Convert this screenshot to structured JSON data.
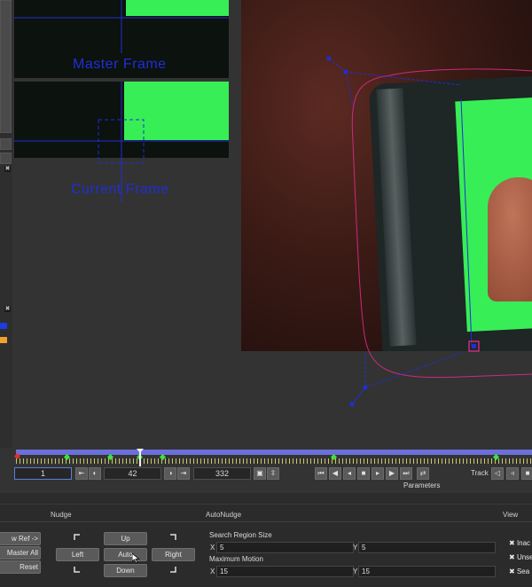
{
  "thumbnails": {
    "master_label": "Master Frame",
    "current_label": "Current Frame"
  },
  "timeline": {
    "frame_current": "1",
    "frame_mid": "42",
    "frame_end": "332",
    "track_label": "Track",
    "parameters_label": "Parameters"
  },
  "panel": {
    "left_buttons": [
      "w Ref ->",
      "Master All",
      "Reset"
    ],
    "nudge": {
      "title": "Nudge",
      "up": "Up",
      "left": "Left",
      "auto": "Auto",
      "right": "Right",
      "down": "Down"
    },
    "autonudge": {
      "title": "AutoNudge",
      "search_region_label": "Search Region Size",
      "search_x_label": "X",
      "search_x": "5",
      "search_y_label": "Y",
      "search_y": "5",
      "max_motion_label": "Maximum Motion",
      "motion_x_label": "X",
      "motion_x": "15",
      "motion_y_label": "Y",
      "motion_y": "15"
    },
    "view": {
      "title": "View",
      "checks": [
        "Inac",
        "Unse",
        "Sea"
      ]
    }
  },
  "colors": {
    "keyframe": "#3ce63c",
    "track_line": "#6b6fd8",
    "tracker_blue": "#1f2fd6",
    "spline_magenta": "#cc2a7a",
    "screen_green": "#38ee56"
  }
}
